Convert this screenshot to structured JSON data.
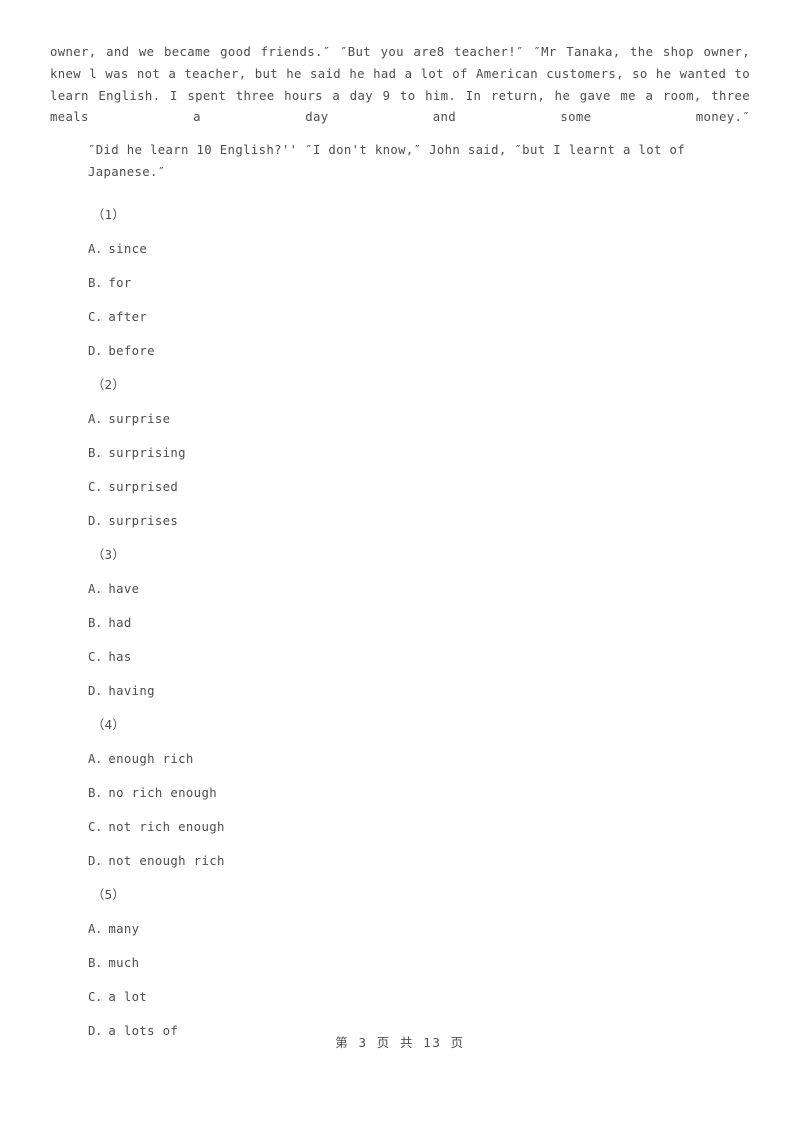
{
  "document": {
    "type": "exam-paper-page",
    "text_color": "#4d4d4d",
    "background_color": "#ffffff",
    "passages": [
      {
        "id": "passage-continued",
        "text": "owner, and we became good friends.″ ″But you are8  teacher!″ ″Mr Tanaka, the shop owner, knew l was not a teacher, but he said he had a lot of American customers, so he wanted to learn English. I spent three hours a day 9  to him. In return, he gave me a room, three meals a day and some money.″"
      },
      {
        "id": "passage-dialogue",
        "text": "″Did he learn 10 English?'' ″I don't know,″ John said, ″but I learnt a lot of Japanese.″"
      }
    ],
    "questions": [
      {
        "number": "（1）",
        "options": [
          "A．since",
          "B．for",
          "C．after",
          "D．before"
        ]
      },
      {
        "number": "（2）",
        "options": [
          "A．surprise",
          "B．surprising",
          "C．surprised",
          "D．surprises"
        ]
      },
      {
        "number": "（3）",
        "options": [
          "A．have",
          "B．had",
          "C．has",
          "D．having"
        ]
      },
      {
        "number": "（4）",
        "options": [
          "A．enough rich",
          "B．no rich enough",
          "C．not rich enough",
          "D．not enough rich"
        ]
      },
      {
        "number": "（5）",
        "options": [
          "A．many",
          "B．much",
          "C．a lot",
          "D．a lots of"
        ]
      }
    ],
    "footer": {
      "text": "第 3 页 共 13 页",
      "current_page": "3",
      "total_pages": "13"
    }
  }
}
